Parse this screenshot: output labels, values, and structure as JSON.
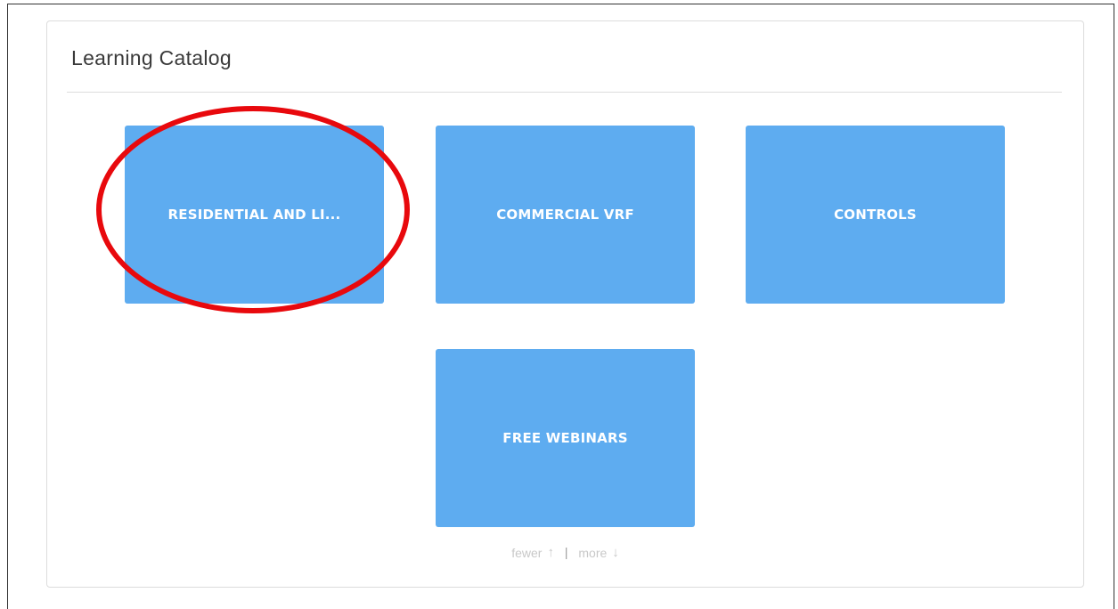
{
  "catalog": {
    "title": "Learning Catalog",
    "tiles": [
      {
        "label": "RESIDENTIAL AND LI..."
      },
      {
        "label": "COMMERCIAL VRF"
      },
      {
        "label": "CONTROLS"
      },
      {
        "label": "FREE WEBINARS"
      }
    ],
    "pager": {
      "fewer_label": "fewer",
      "separator": "|",
      "more_label": "more"
    }
  },
  "icons": {
    "fewer": "arrow-up-icon",
    "more": "arrow-down-icon"
  },
  "colors": {
    "tile_background": "#5eacf0",
    "tile_text": "#ffffff",
    "highlight": "#e8090d",
    "pager_text": "#c8c8c8"
  }
}
